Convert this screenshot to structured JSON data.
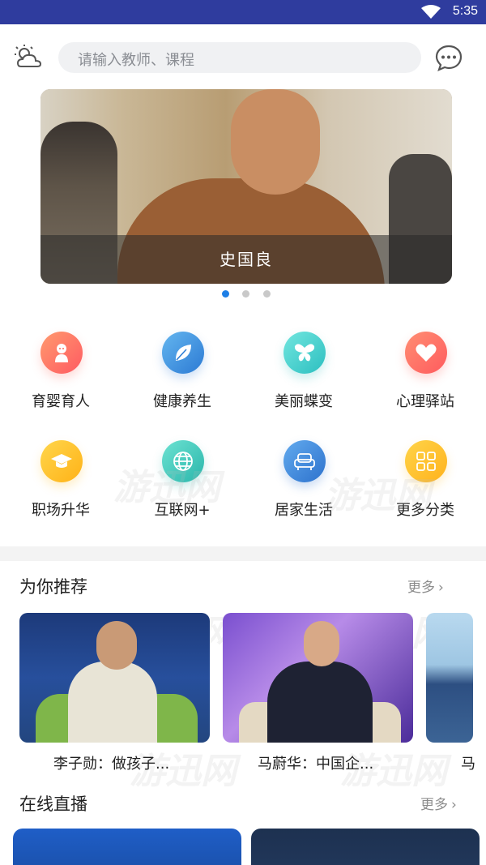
{
  "status_bar": {
    "time": "5:35"
  },
  "search": {
    "placeholder": "请输入教师、课程"
  },
  "banner": {
    "caption": "史国良",
    "dots": [
      true,
      false,
      false
    ]
  },
  "categories": [
    {
      "label": "育婴育人",
      "icon": "baby-icon",
      "color_from": "#ff8d6a",
      "color_to": "#ff5b62"
    },
    {
      "label": "健康养生",
      "icon": "leaf-icon",
      "color_from": "#5fb4ee",
      "color_to": "#2f7fd6"
    },
    {
      "label": "美丽蝶变",
      "icon": "butterfly-icon",
      "color_from": "#6ee4de",
      "color_to": "#2fc2c2"
    },
    {
      "label": "心理驿站",
      "icon": "heart-icon",
      "color_from": "#ff8b73",
      "color_to": "#ff5d5d"
    },
    {
      "label": "职场升华",
      "icon": "graduation-cap-icon",
      "color_from": "#ffd34a",
      "color_to": "#ffb319"
    },
    {
      "label": "互联网+",
      "icon": "globe-icon",
      "color_from": "#6ae0d0",
      "color_to": "#2cb8ad"
    },
    {
      "label": "居家生活",
      "icon": "sofa-icon",
      "color_from": "#5fa8ee",
      "color_to": "#2f74cf"
    },
    {
      "label": "更多分类",
      "icon": "grid-apps-icon",
      "color_from": "#ffd347",
      "color_to": "#ffb31e"
    }
  ],
  "recommend": {
    "title": "为你推荐",
    "more": "更多",
    "items": [
      {
        "name": "李子勋：做孩子..."
      },
      {
        "name": "马蔚华：中国企..."
      },
      {
        "name": "马"
      }
    ]
  },
  "live": {
    "title": "在线直播",
    "more": "更多"
  },
  "watermark_text": "游迅网"
}
